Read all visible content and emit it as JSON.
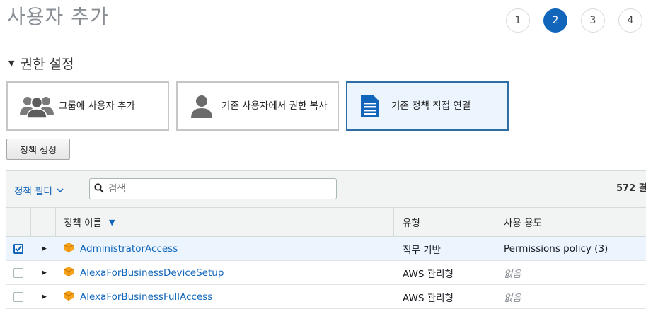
{
  "header": {
    "title": "사용자 추가",
    "steps": [
      "1",
      "2",
      "3",
      "4"
    ],
    "active_step": "2"
  },
  "permissions": {
    "section_title": "권한 설정",
    "options": [
      {
        "label": "그룹에 사용자 추가",
        "icon": "group-icon",
        "selected": false
      },
      {
        "label": "기존 사용자에서 권한 복사",
        "icon": "user-icon",
        "selected": false
      },
      {
        "label": "기존 정책 직접 연결",
        "icon": "document-icon",
        "selected": true
      }
    ],
    "create_policy_label": "정책 생성"
  },
  "filter": {
    "label": "정책 필터",
    "search_placeholder": "검색",
    "result_count": "572 결"
  },
  "table": {
    "columns": [
      "정책 이름",
      "유형",
      "사용 용도"
    ],
    "rows": [
      {
        "name": "AdministratorAccess",
        "type": "직무 기반",
        "usage": "Permissions policy (3)",
        "checked": true
      },
      {
        "name": "AlexaForBusinessDeviceSetup",
        "type": "AWS 관리형",
        "usage": "없음",
        "checked": false
      },
      {
        "name": "AlexaForBusinessFullAccess",
        "type": "AWS 관리형",
        "usage": "없음",
        "checked": false
      }
    ]
  },
  "colors": {
    "accent": "#1166bb",
    "selected_bg": "#ecf4fd",
    "policy_icon": "#f7a21b"
  }
}
